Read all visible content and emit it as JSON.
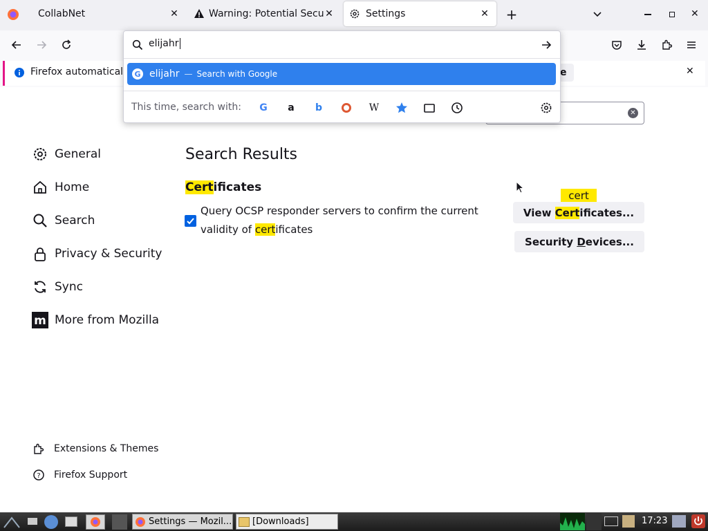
{
  "tabs": [
    {
      "label": "CollabNet",
      "icon": "firefox-icon"
    },
    {
      "label": "Warning: Potential Security Risk Ahead",
      "icon": "warning-icon"
    },
    {
      "label": "Settings",
      "icon": "gear-icon",
      "active": true
    }
  ],
  "urlbar": {
    "value": "elijahr",
    "suggestion_text": "elijahr",
    "suggestion_action": "Search with Google",
    "oneoff_label": "This time, search with:"
  },
  "notification": {
    "text": "Firefox automatically",
    "button_tail": "e"
  },
  "settings": {
    "nav": [
      {
        "label": "General",
        "icon": "gear-icon"
      },
      {
        "label": "Home",
        "icon": "home-icon"
      },
      {
        "label": "Search",
        "icon": "search-icon"
      },
      {
        "label": "Privacy & Security",
        "icon": "lock-icon"
      },
      {
        "label": "Sync",
        "icon": "sync-icon"
      },
      {
        "label": "More from Mozilla",
        "icon": "mozilla-icon"
      }
    ],
    "footer": [
      {
        "label": "Extensions & Themes",
        "icon": "puzzle-icon"
      },
      {
        "label": "Firefox Support",
        "icon": "help-icon"
      }
    ],
    "results_heading": "Search Results",
    "section_title_hl": "Cert",
    "section_title_rest": "ificates",
    "ocsp_line1": "Query OCSP responder servers to confirm the current",
    "ocsp_line2_pre": "validity of ",
    "ocsp_line2_hl": "cert",
    "ocsp_line2_post": "ificates",
    "ocsp_checked": true,
    "tooltip": "cert",
    "view_btn_pre": "View ",
    "view_btn_hl": "Cert",
    "view_btn_post": "ificates...",
    "devices_btn_pre": "Security ",
    "devices_btn_ul": "D",
    "devices_btn_post": "evices..."
  },
  "taskbar": {
    "task1": "Settings — Mozil...",
    "task2": "[Downloads]",
    "clock": "17:23"
  },
  "colors": {
    "accent": "#2f80ed",
    "highlight": "#ffe900",
    "checkbox": "#0061e0"
  }
}
